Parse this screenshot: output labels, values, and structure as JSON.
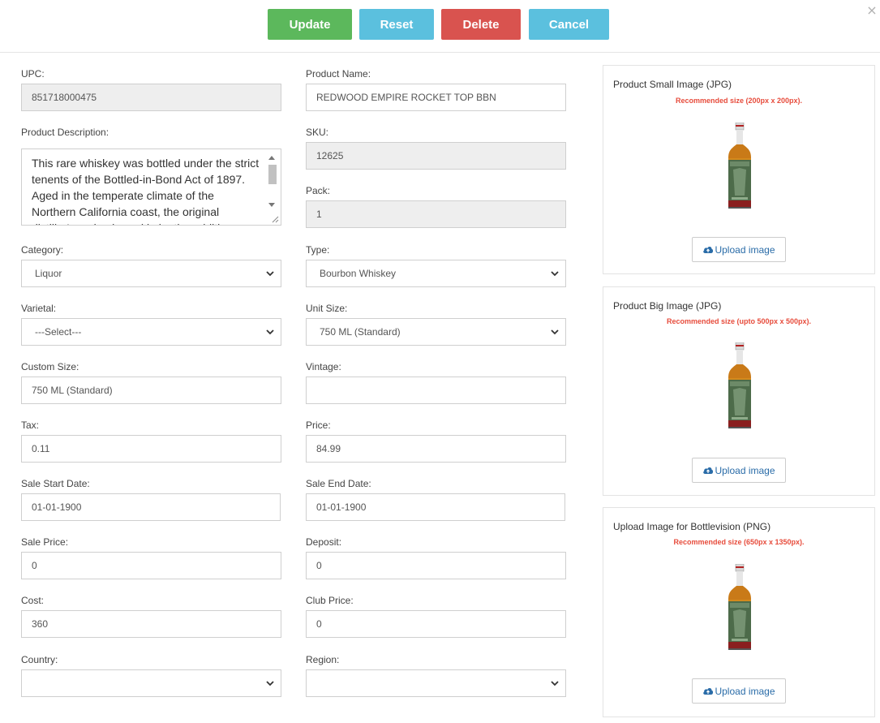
{
  "toolbar": {
    "update_label": "Update",
    "reset_label": "Reset",
    "delete_label": "Delete",
    "cancel_label": "Cancel",
    "close_symbol": "×"
  },
  "form": {
    "upc": {
      "label": "UPC:",
      "value": "851718000475"
    },
    "product_name": {
      "label": "Product Name:",
      "value": "REDWOOD EMPIRE ROCKET TOP BBN"
    },
    "description": {
      "label": "Product Description:",
      "value": "This rare whiskey was bottled under the strict tenents of the Bottled-in-Bond Act of 1897. Aged in the temperate climate of the Northern California coast, the original distiller's recipe honed in by the addition"
    },
    "sku": {
      "label": "SKU:",
      "value": "12625"
    },
    "pack": {
      "label": "Pack:",
      "value": "1"
    },
    "category": {
      "label": "Category:",
      "value": "Liquor"
    },
    "type": {
      "label": "Type:",
      "value": "Bourbon Whiskey"
    },
    "varietal": {
      "label": "Varietal:",
      "value": "---Select---"
    },
    "unit_size": {
      "label": "Unit Size:",
      "value": "750 ML (Standard)"
    },
    "custom_size": {
      "label": "Custom Size:",
      "value": "750 ML (Standard)"
    },
    "vintage": {
      "label": "Vintage:",
      "value": ""
    },
    "tax": {
      "label": "Tax:",
      "value": "0.11"
    },
    "price": {
      "label": "Price:",
      "value": "84.99"
    },
    "sale_start_date": {
      "label": "Sale Start Date:",
      "value": "01-01-1900"
    },
    "sale_end_date": {
      "label": "Sale End Date:",
      "value": "01-01-1900"
    },
    "sale_price": {
      "label": "Sale Price:",
      "value": "0"
    },
    "deposit": {
      "label": "Deposit:",
      "value": "0"
    },
    "cost": {
      "label": "Cost:",
      "value": "360"
    },
    "club_price": {
      "label": "Club Price:",
      "value": "0"
    },
    "country": {
      "label": "Country:",
      "value": ""
    },
    "region": {
      "label": "Region:",
      "value": ""
    }
  },
  "images": {
    "small": {
      "title": "Product Small Image (JPG)",
      "recommended": "Recommended size (200px x 200px).",
      "upload_label": "Upload image"
    },
    "big": {
      "title": "Product Big Image (JPG)",
      "recommended": "Recommended size (upto 500px x 500px).",
      "upload_label": "Upload image"
    },
    "bottlevision": {
      "title": "Upload Image for Bottlevision (PNG)",
      "recommended": "Recommended size (650px x 1350px).",
      "upload_label": "Upload image"
    }
  },
  "icons": {
    "upload": "cloud-upload-icon",
    "dropdown": "chevron-down-icon",
    "close": "close-icon"
  },
  "colors": {
    "update": "#5cb85c",
    "reset": "#5bc0de",
    "delete": "#d9534f",
    "cancel": "#5bc0de",
    "recommended_text": "#e74c3c",
    "upload_text": "#2a6ca8",
    "readonly_bg": "#eeeeee"
  }
}
